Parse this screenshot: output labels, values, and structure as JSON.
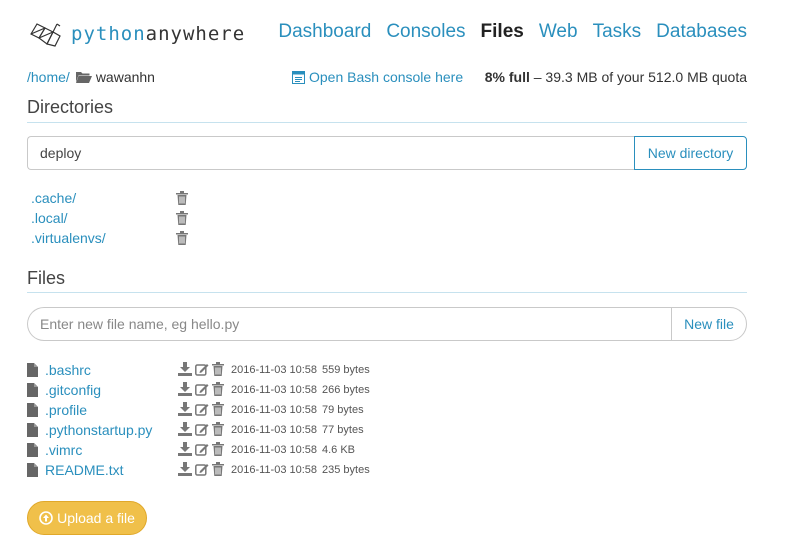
{
  "header": {
    "logo_text_a": "python",
    "logo_text_b": "anywhere",
    "nav": [
      {
        "label": "Dashboard",
        "active": false
      },
      {
        "label": "Consoles",
        "active": false
      },
      {
        "label": "Files",
        "active": true
      },
      {
        "label": "Web",
        "active": false
      },
      {
        "label": "Tasks",
        "active": false
      },
      {
        "label": "Databases",
        "active": false
      }
    ]
  },
  "path": {
    "home": "/home/",
    "current": "wawanhn",
    "bash_link": "Open Bash console here",
    "quota_bold": "8% full",
    "quota_rest": " – 39.3 MB of your 512.0 MB quota"
  },
  "directories": {
    "title": "Directories",
    "input_value": "deploy",
    "button": "New directory",
    "items": [
      ".cache/",
      ".local/",
      ".virtualenvs/"
    ]
  },
  "files": {
    "title": "Files",
    "input_placeholder": "Enter new file name, eg hello.py",
    "button": "New file",
    "items": [
      {
        "name": ".bashrc",
        "date": "2016-11-03 10:58",
        "size": "559 bytes"
      },
      {
        "name": ".gitconfig",
        "date": "2016-11-03 10:58",
        "size": "266 bytes"
      },
      {
        "name": ".profile",
        "date": "2016-11-03 10:58",
        "size": "79 bytes"
      },
      {
        "name": ".pythonstartup.py",
        "date": "2016-11-03 10:58",
        "size": "77 bytes"
      },
      {
        "name": ".vimrc",
        "date": "2016-11-03 10:58",
        "size": "4.6 KB"
      },
      {
        "name": "README.txt",
        "date": "2016-11-03 10:58",
        "size": "235 bytes"
      }
    ]
  },
  "upload_button": "Upload a file",
  "colors": {
    "accent": "#2a8fbd",
    "upload": "#f0c04a"
  }
}
